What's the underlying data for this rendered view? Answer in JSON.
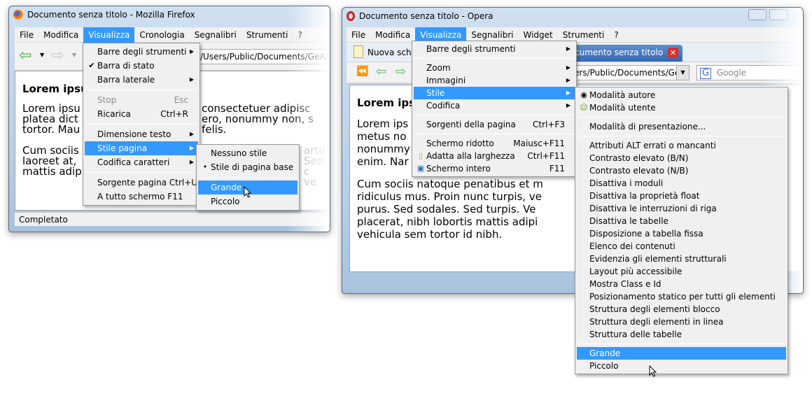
{
  "firefox": {
    "title": "Documento senza titolo - Mozilla Firefox",
    "menubar": [
      "File",
      "Modifica",
      "Visualizza",
      "Cronologia",
      "Segnalibri",
      "Strumenti",
      "?"
    ],
    "active_menu": "Visualizza",
    "address": "/Users/Public/Documents/GeA/",
    "status": "Completato",
    "content": {
      "heading": "Lorem ipsu",
      "p1_lines": [
        "Lorem ipsu",
        "platea dict",
        "tortor. Mau"
      ],
      "p1_right": [
        "consectetuer adipisc",
        "ero, nonummy non, s",
        "felis."
      ],
      "p2_lines": [
        "Cum sociis",
        "laoreet at,",
        "mattis adip"
      ],
      "p2_right": [
        "artu",
        "Sed",
        "c ve"
      ]
    },
    "view_menu": {
      "items": [
        {
          "label": "Barre degli strumenti",
          "submenu": true
        },
        {
          "label": "Barra di stato",
          "checked": true
        },
        {
          "label": "Barra laterale",
          "submenu": true
        },
        {
          "separator": true
        },
        {
          "label": "Stop",
          "shortcut": "Esc",
          "disabled": true
        },
        {
          "label": "Ricarica",
          "shortcut": "Ctrl+R"
        },
        {
          "separator": true
        },
        {
          "label": "Dimensione testo",
          "submenu": true
        },
        {
          "label": "Stile pagina",
          "submenu": true,
          "highlighted": true
        },
        {
          "label": "Codifica caratteri",
          "submenu": true
        },
        {
          "separator": true
        },
        {
          "label": "Sorgente pagina Ctrl+U"
        },
        {
          "label": "A tutto schermo F11"
        }
      ]
    },
    "style_submenu": {
      "items": [
        {
          "label": "Nessuno stile"
        },
        {
          "label": "Stile di pagina base",
          "bullet": true
        },
        {
          "separator": true
        },
        {
          "label": "Grande",
          "highlighted": true
        },
        {
          "label": "Piccolo"
        }
      ]
    }
  },
  "opera": {
    "title": "Documento senza titolo - Opera",
    "menubar": [
      "File",
      "Modifica",
      "Visualizza",
      "Segnalibri",
      "Widget",
      "Strumenti",
      "?"
    ],
    "active_menu": "Visualizza",
    "new_tab_label": "Nuova sche",
    "active_tab_label": "cumento senza titolo",
    "address": "ers/Public/Documents/Ge/",
    "search_placeholder": "Google",
    "content": {
      "heading": "Lorem ips",
      "p1_lines": [
        "Lorem ips",
        "metus no",
        "nonummy",
        "enim. Nar"
      ],
      "p2_lines": [
        "Cum sociis natoque penatibus et m",
        "ridiculus mus. Proin nunc turpis, ve",
        "purus. Sed sodales. Sed turpis. Ve",
        "placerat, nibh lobortis mattis adipi",
        "vehicula sem tortor id nibh."
      ]
    },
    "view_menu": {
      "items": [
        {
          "label": "Barre degli strumenti",
          "submenu": true
        },
        {
          "separator": true
        },
        {
          "label": "Zoom",
          "submenu": true
        },
        {
          "label": "Immagini",
          "submenu": true
        },
        {
          "label": "Stile",
          "submenu": true,
          "highlighted": true
        },
        {
          "label": "Codifica",
          "submenu": true
        },
        {
          "separator": true
        },
        {
          "label": "Sorgenti della pagina",
          "shortcut": "Ctrl+F3"
        },
        {
          "separator": true
        },
        {
          "label": "Schermo ridotto",
          "shortcut": "Maiusc+F11"
        },
        {
          "label": "Adatta alla larghezza",
          "shortcut": "Ctrl+F11",
          "icon": "page-fit-icon"
        },
        {
          "label": "Schermo intero",
          "shortcut": "F11",
          "icon": "fullscreen-icon"
        }
      ]
    },
    "style_submenu": {
      "items": [
        {
          "label": "Modalità autore",
          "radio": true
        },
        {
          "label": "Modalità utente",
          "icon": "user-icon"
        },
        {
          "separator": true
        },
        {
          "label": "Modalità di presentazione..."
        },
        {
          "separator": true
        },
        {
          "label": "Attributi ALT errati o mancanti"
        },
        {
          "label": "Contrasto elevato (B/N)"
        },
        {
          "label": "Contrasto elevato (N/B)"
        },
        {
          "label": "Disattiva i moduli"
        },
        {
          "label": "Disattiva la proprietà float"
        },
        {
          "label": "Disattiva le interruzioni di riga"
        },
        {
          "label": "Disattiva le tabelle"
        },
        {
          "label": "Disposizione a tabella fissa"
        },
        {
          "label": "Elenco dei contenuti"
        },
        {
          "label": "Evidenzia gli elementi strutturali"
        },
        {
          "label": "Layout più accessibile"
        },
        {
          "label": "Mostra Class e Id"
        },
        {
          "label": "Posizionamento statico per tutti gli elementi"
        },
        {
          "label": "Struttura degli elementi blocco"
        },
        {
          "label": "Struttura degli elementi in linea"
        },
        {
          "label": "Struttura delle tabelle"
        },
        {
          "separator": true
        },
        {
          "label": "Grande",
          "highlighted": true
        },
        {
          "label": "Piccolo"
        }
      ]
    }
  },
  "colors": {
    "highlight": "#3399ff",
    "menu_bg": "#f0f0f0"
  }
}
